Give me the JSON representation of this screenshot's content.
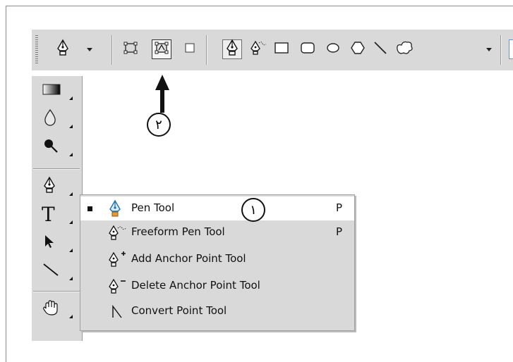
{
  "options_bar": {
    "tool_icon": "pen-icon",
    "path_mode_icons": [
      "shape-layers-icon",
      "paths-icon",
      "fill-pixels-icon"
    ],
    "selected_path_mode": "paths-icon",
    "tools": [
      "pen-icon",
      "freeform-pen-icon",
      "rectangle-icon",
      "rounded-rectangle-icon",
      "ellipse-icon",
      "polygon-icon",
      "line-icon",
      "custom-shape-icon"
    ],
    "selected_tool": "pen-icon"
  },
  "toolbox": {
    "tools": [
      "gradient-icon",
      "blur-icon",
      "dodge-icon",
      "pen-icon",
      "type-icon",
      "path-selection-icon",
      "line-icon",
      "hand-icon"
    ],
    "type_label": "T"
  },
  "flyout": {
    "items": [
      {
        "label": "Pen Tool",
        "shortcut": "P",
        "icon": "pen-icon",
        "active": true
      },
      {
        "label": "Freeform Pen Tool",
        "shortcut": "P",
        "icon": "freeform-pen-icon"
      },
      {
        "label": "Add Anchor Point Tool",
        "shortcut": "",
        "icon": "add-anchor-icon"
      },
      {
        "label": "Delete Anchor Point Tool",
        "shortcut": "",
        "icon": "delete-anchor-icon"
      },
      {
        "label": "Convert Point Tool",
        "shortcut": "",
        "icon": "convert-point-icon"
      }
    ]
  },
  "annotations": {
    "marker_1": "١",
    "marker_2": "٢"
  }
}
